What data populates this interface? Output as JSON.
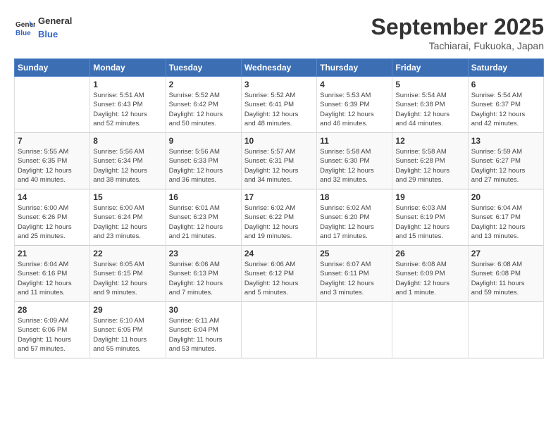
{
  "header": {
    "logo": {
      "line1": "General",
      "line2": "Blue"
    },
    "title": "September 2025",
    "subtitle": "Tachiarai, Fukuoka, Japan"
  },
  "columns": [
    "Sunday",
    "Monday",
    "Tuesday",
    "Wednesday",
    "Thursday",
    "Friday",
    "Saturday"
  ],
  "weeks": [
    [
      {
        "day": "",
        "info": ""
      },
      {
        "day": "1",
        "info": "Sunrise: 5:51 AM\nSunset: 6:43 PM\nDaylight: 12 hours\nand 52 minutes."
      },
      {
        "day": "2",
        "info": "Sunrise: 5:52 AM\nSunset: 6:42 PM\nDaylight: 12 hours\nand 50 minutes."
      },
      {
        "day": "3",
        "info": "Sunrise: 5:52 AM\nSunset: 6:41 PM\nDaylight: 12 hours\nand 48 minutes."
      },
      {
        "day": "4",
        "info": "Sunrise: 5:53 AM\nSunset: 6:39 PM\nDaylight: 12 hours\nand 46 minutes."
      },
      {
        "day": "5",
        "info": "Sunrise: 5:54 AM\nSunset: 6:38 PM\nDaylight: 12 hours\nand 44 minutes."
      },
      {
        "day": "6",
        "info": "Sunrise: 5:54 AM\nSunset: 6:37 PM\nDaylight: 12 hours\nand 42 minutes."
      }
    ],
    [
      {
        "day": "7",
        "info": "Sunrise: 5:55 AM\nSunset: 6:35 PM\nDaylight: 12 hours\nand 40 minutes."
      },
      {
        "day": "8",
        "info": "Sunrise: 5:56 AM\nSunset: 6:34 PM\nDaylight: 12 hours\nand 38 minutes."
      },
      {
        "day": "9",
        "info": "Sunrise: 5:56 AM\nSunset: 6:33 PM\nDaylight: 12 hours\nand 36 minutes."
      },
      {
        "day": "10",
        "info": "Sunrise: 5:57 AM\nSunset: 6:31 PM\nDaylight: 12 hours\nand 34 minutes."
      },
      {
        "day": "11",
        "info": "Sunrise: 5:58 AM\nSunset: 6:30 PM\nDaylight: 12 hours\nand 32 minutes."
      },
      {
        "day": "12",
        "info": "Sunrise: 5:58 AM\nSunset: 6:28 PM\nDaylight: 12 hours\nand 29 minutes."
      },
      {
        "day": "13",
        "info": "Sunrise: 5:59 AM\nSunset: 6:27 PM\nDaylight: 12 hours\nand 27 minutes."
      }
    ],
    [
      {
        "day": "14",
        "info": "Sunrise: 6:00 AM\nSunset: 6:26 PM\nDaylight: 12 hours\nand 25 minutes."
      },
      {
        "day": "15",
        "info": "Sunrise: 6:00 AM\nSunset: 6:24 PM\nDaylight: 12 hours\nand 23 minutes."
      },
      {
        "day": "16",
        "info": "Sunrise: 6:01 AM\nSunset: 6:23 PM\nDaylight: 12 hours\nand 21 minutes."
      },
      {
        "day": "17",
        "info": "Sunrise: 6:02 AM\nSunset: 6:22 PM\nDaylight: 12 hours\nand 19 minutes."
      },
      {
        "day": "18",
        "info": "Sunrise: 6:02 AM\nSunset: 6:20 PM\nDaylight: 12 hours\nand 17 minutes."
      },
      {
        "day": "19",
        "info": "Sunrise: 6:03 AM\nSunset: 6:19 PM\nDaylight: 12 hours\nand 15 minutes."
      },
      {
        "day": "20",
        "info": "Sunrise: 6:04 AM\nSunset: 6:17 PM\nDaylight: 12 hours\nand 13 minutes."
      }
    ],
    [
      {
        "day": "21",
        "info": "Sunrise: 6:04 AM\nSunset: 6:16 PM\nDaylight: 12 hours\nand 11 minutes."
      },
      {
        "day": "22",
        "info": "Sunrise: 6:05 AM\nSunset: 6:15 PM\nDaylight: 12 hours\nand 9 minutes."
      },
      {
        "day": "23",
        "info": "Sunrise: 6:06 AM\nSunset: 6:13 PM\nDaylight: 12 hours\nand 7 minutes."
      },
      {
        "day": "24",
        "info": "Sunrise: 6:06 AM\nSunset: 6:12 PM\nDaylight: 12 hours\nand 5 minutes."
      },
      {
        "day": "25",
        "info": "Sunrise: 6:07 AM\nSunset: 6:11 PM\nDaylight: 12 hours\nand 3 minutes."
      },
      {
        "day": "26",
        "info": "Sunrise: 6:08 AM\nSunset: 6:09 PM\nDaylight: 12 hours\nand 1 minute."
      },
      {
        "day": "27",
        "info": "Sunrise: 6:08 AM\nSunset: 6:08 PM\nDaylight: 11 hours\nand 59 minutes."
      }
    ],
    [
      {
        "day": "28",
        "info": "Sunrise: 6:09 AM\nSunset: 6:06 PM\nDaylight: 11 hours\nand 57 minutes."
      },
      {
        "day": "29",
        "info": "Sunrise: 6:10 AM\nSunset: 6:05 PM\nDaylight: 11 hours\nand 55 minutes."
      },
      {
        "day": "30",
        "info": "Sunrise: 6:11 AM\nSunset: 6:04 PM\nDaylight: 11 hours\nand 53 minutes."
      },
      {
        "day": "",
        "info": ""
      },
      {
        "day": "",
        "info": ""
      },
      {
        "day": "",
        "info": ""
      },
      {
        "day": "",
        "info": ""
      }
    ]
  ]
}
